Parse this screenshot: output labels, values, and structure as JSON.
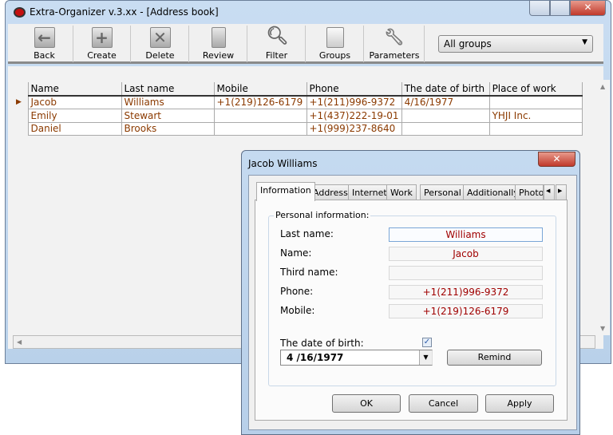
{
  "window": {
    "title": "Extra-Organizer v.3.xx  - [Address book]"
  },
  "toolbar": {
    "items": [
      {
        "label": "Back",
        "icon": "back-arrow-icon"
      },
      {
        "label": "Create",
        "icon": "plus-icon"
      },
      {
        "label": "Delete",
        "icon": "delete-x-icon"
      },
      {
        "label": "Review",
        "icon": "contact-card-icon"
      },
      {
        "label": "Filter",
        "icon": "magnifier-icon"
      },
      {
        "label": "Groups",
        "icon": "documents-icon"
      },
      {
        "label": "Parameters",
        "icon": "wrench-icon"
      }
    ],
    "group_select": "All groups"
  },
  "grid": {
    "headers": [
      "Name",
      "Last name",
      "Mobile",
      "Phone",
      "The date of birth",
      "Place of work"
    ],
    "rows": [
      [
        "Jacob",
        "Williams",
        "+1(219)126-6179",
        "+1(211)996-9372",
        "4/16/1977",
        ""
      ],
      [
        "Emily",
        "Stewart",
        "",
        "+1(437)222-19-01",
        "",
        "YHJI Inc."
      ],
      [
        "Daniel",
        "Brooks",
        "",
        "+1(999)237-8640",
        "",
        ""
      ]
    ]
  },
  "dialog": {
    "title": "Jacob Williams",
    "tabs": [
      "Information",
      "Address",
      "Internet",
      "Work",
      "Personal",
      "Additionally",
      "Photo"
    ],
    "group_label": "Personal information:",
    "fields": [
      {
        "label": "Last name:",
        "value": "Williams"
      },
      {
        "label": "Name:",
        "value": "Jacob"
      },
      {
        "label": "Third name:",
        "value": ""
      },
      {
        "label": "Phone:",
        "value": "+1(211)996-9372"
      },
      {
        "label": "Mobile:",
        "value": "+1(219)126-6179"
      }
    ],
    "dob_label": "The date of birth:",
    "dob_value": "4 /16/1977",
    "dob_checked": true,
    "remind": "Remind",
    "ok": "OK",
    "cancel": "Cancel",
    "apply": "Apply"
  }
}
